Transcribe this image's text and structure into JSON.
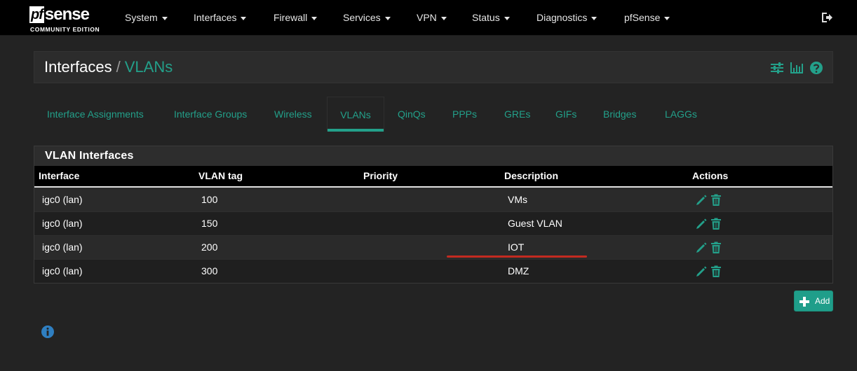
{
  "brand": {
    "logo_pf": "pf",
    "logo_sense": "sense",
    "logo_sub": "COMMUNITY EDITION"
  },
  "nav": {
    "items": [
      {
        "label": "System"
      },
      {
        "label": "Interfaces"
      },
      {
        "label": "Firewall"
      },
      {
        "label": "Services"
      },
      {
        "label": "VPN"
      },
      {
        "label": "Status"
      },
      {
        "label": "Diagnostics"
      },
      {
        "label": "pfSense"
      }
    ],
    "logout_icon": "logout-icon"
  },
  "header": {
    "breadcrumb_first": "Interfaces",
    "breadcrumb_sep": "/",
    "breadcrumb_second": "VLANs",
    "icons": [
      "sliders-icon",
      "bar-chart-icon",
      "help-icon"
    ]
  },
  "tabs": [
    {
      "label": "Interface Assignments"
    },
    {
      "label": "Interface Groups"
    },
    {
      "label": "Wireless"
    },
    {
      "label": "VLANs",
      "active": true
    },
    {
      "label": "QinQs"
    },
    {
      "label": "PPPs"
    },
    {
      "label": "GREs"
    },
    {
      "label": "GIFs"
    },
    {
      "label": "Bridges"
    },
    {
      "label": "LAGGs"
    }
  ],
  "panel": {
    "title": "VLAN Interfaces",
    "columns": [
      "Interface",
      "VLAN tag",
      "Priority",
      "Description",
      "Actions"
    ],
    "rows": [
      {
        "interface": "igc0 (lan)",
        "tag": "100",
        "priority": "",
        "description": "VMs"
      },
      {
        "interface": "igc0 (lan)",
        "tag": "150",
        "priority": "",
        "description": "Guest VLAN"
      },
      {
        "interface": "igc0 (lan)",
        "tag": "200",
        "priority": "",
        "description": "IOT"
      },
      {
        "interface": "igc0 (lan)",
        "tag": "300",
        "priority": "",
        "description": "DMZ"
      }
    ]
  },
  "add_button": {
    "label": "Add"
  },
  "colors": {
    "accent": "#23a08a",
    "navbar": "#000000",
    "background": "#232323",
    "annotation": "#d42a1f"
  }
}
